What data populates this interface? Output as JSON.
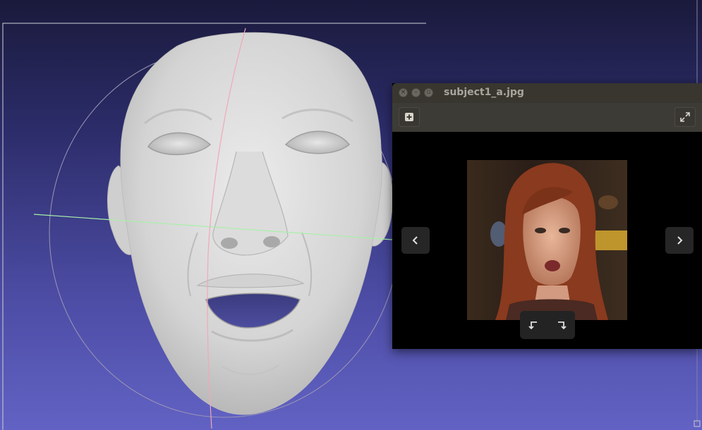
{
  "scene": {
    "background_top": "#1a1a3c",
    "background_bottom": "#6262c4",
    "mesh_color": "#d8d8d8",
    "axis_x_color": "#a8f0a8",
    "axis_y_color": "#f0a8b8",
    "trackball_color": "#9a96b4"
  },
  "viewer": {
    "title": "subject1_a.jpg",
    "window_buttons": [
      "close-icon",
      "minimize-icon",
      "maximize-icon"
    ],
    "toolbar": {
      "add_icon": "plus-square-icon",
      "fullscreen_icon": "expand-icon"
    },
    "navigation": {
      "prev_icon": "chevron-left-icon",
      "next_icon": "chevron-right-icon"
    },
    "rotate": {
      "left_icon": "rotate-left-icon",
      "right_icon": "rotate-right-icon"
    }
  }
}
